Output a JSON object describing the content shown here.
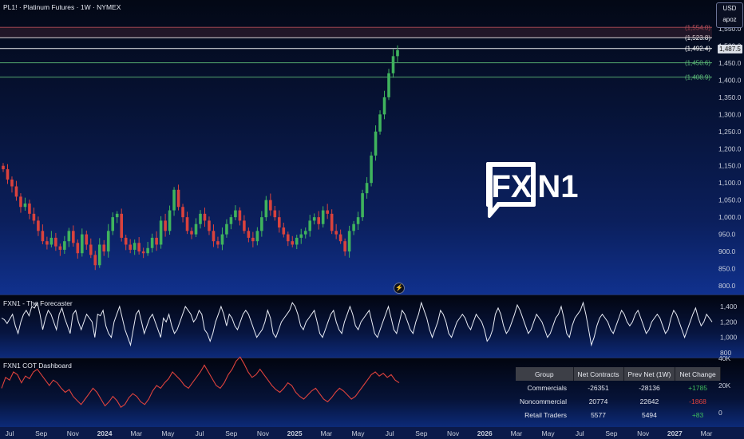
{
  "symbol_title": "PL1! · Platinum Futures · 1W · NYMEX",
  "currency": "USD",
  "scale_mode": "apoz",
  "last_price": "1,487.5",
  "logo_text_left": "FX",
  "logo_text_right": "N1",
  "chart_data": [
    {
      "type": "candlestick",
      "title": "PL1! · Platinum Futures · 1W · NYMEX",
      "y_ticks": [
        "1,550.0",
        "1,500.0",
        "1,450.0",
        "1,400.0",
        "1,350.0",
        "1,300.0",
        "1,250.0",
        "1,200.0",
        "1,150.0",
        "1,100.0",
        "1,050.0",
        "1,000.0",
        "950.0",
        "900.0",
        "850.0",
        "800.0"
      ],
      "ylim": [
        780,
        1560
      ],
      "x_ticks": [
        "Jul",
        "Sep",
        "Nov",
        "2024",
        "Mar",
        "May",
        "Jul",
        "Sep",
        "Nov",
        "2025",
        "Mar",
        "May",
        "Jul",
        "Sep",
        "Nov",
        "2026",
        "Mar",
        "May",
        "Jul",
        "Sep",
        "Nov",
        "2027",
        "Mar"
      ],
      "close_approx": [
        1140,
        1110,
        1090,
        1060,
        1030,
        1040,
        1010,
        990,
        960,
        930,
        920,
        940,
        915,
        905,
        930,
        960,
        925,
        895,
        950,
        920,
        890,
        860,
        920,
        900,
        960,
        1000,
        1010,
        940,
        920,
        905,
        925,
        900,
        895,
        910,
        940,
        920,
        990,
        960,
        1020,
        1080,
        1030,
        1000,
        960,
        950,
        980,
        1010,
        990,
        960,
        930,
        920,
        950,
        980,
        1000,
        1020,
        990,
        960,
        940,
        930,
        960,
        1000,
        1050,
        1020,
        1000,
        970,
        950,
        930,
        920,
        940,
        950,
        960,
        990,
        1000,
        980,
        1020,
        1010,
        960,
        950,
        930,
        900,
        960,
        980,
        1000,
        1070,
        1100,
        1180,
        1250,
        1300,
        1350,
        1420,
        1470,
        1487.5
      ],
      "horizontal_levels": [
        {
          "label": "(1,554.0)",
          "value": 1554.0,
          "color": "#c9555f"
        },
        {
          "label": "(1,523.8)",
          "value": 1523.8,
          "color": "#ffffff"
        },
        {
          "label": "(1,492.4)",
          "value": 1492.4,
          "color": "#ffffff"
        },
        {
          "label": "(1,450.6)",
          "value": 1450.6,
          "color": "#5fbf7a"
        },
        {
          "label": "(1,408.9)",
          "value": 1408.9,
          "color": "#5fbf7a"
        }
      ],
      "last_price": 1487.5
    },
    {
      "type": "line",
      "title": "FXN1 - The Forecaster",
      "y_ticks": [
        "1,400",
        "1,200",
        "1,000",
        "800"
      ],
      "ylim": [
        800,
        1500
      ],
      "values_approx": [
        1250,
        1230,
        1180,
        1240,
        1300,
        1150,
        1050,
        1200,
        1300,
        1350,
        1280,
        1400,
        1380,
        1450,
        1300,
        1100,
        1250,
        1350,
        1300,
        1200,
        1100,
        1300,
        1380,
        1250,
        1150,
        1050,
        1300,
        1350,
        1200,
        1100,
        1200,
        1300,
        1250,
        1200,
        1000,
        1300,
        1280,
        1350,
        1150,
        1050,
        1000,
        1200,
        1300,
        1400,
        1250,
        1100,
        1000,
        900,
        1100,
        1300,
        1350,
        1200,
        1050,
        1150,
        1250,
        1300,
        1200,
        1100,
        1000,
        1250,
        1200,
        1300,
        1150,
        1050,
        1100,
        1200,
        1300,
        1400,
        1350,
        1300,
        1200,
        1250,
        1350,
        1300,
        1100,
        1050,
        950,
        1050,
        1200,
        1300,
        1400,
        1300,
        1150,
        1300,
        1250,
        1150,
        1100,
        1200,
        1300,
        1350,
        1300,
        1200,
        1100,
        1000,
        1050,
        1100,
        1200,
        1350,
        1250,
        1050,
        1000,
        1100,
        1200,
        1250,
        1300,
        1350,
        1450,
        1400,
        1300,
        1150,
        1100,
        1200,
        1250,
        1300,
        1350,
        1200,
        1050,
        1000,
        1100,
        1200,
        1300,
        1350,
        1200,
        1100,
        1050,
        1200,
        1300,
        1400,
        1300,
        1150,
        1100,
        1200,
        1250,
        1300,
        1350,
        1200,
        1050,
        1000,
        1100,
        1200,
        1300,
        1400,
        1250,
        1100,
        1050,
        1200,
        1350,
        1300,
        1200,
        1100,
        1050,
        1200,
        1300,
        1450,
        1350,
        1250,
        1100,
        1000,
        1100,
        1200,
        1350,
        1300,
        1200,
        1050,
        1000,
        1100,
        1200,
        1250,
        1300,
        1250,
        1150,
        1100,
        1200,
        1300,
        1250,
        1200,
        1100,
        950,
        1000,
        1100,
        1300,
        1380,
        1300,
        1150,
        1050,
        1100,
        1200,
        1300,
        1420,
        1350,
        1250,
        1150,
        1050,
        1100,
        1200,
        1300,
        1250,
        1200,
        1100,
        1000,
        1050,
        1150,
        1250,
        1300,
        1400,
        1250,
        1050,
        1000,
        1150,
        1250,
        1300,
        1350,
        1450,
        1300,
        1100,
        900,
        1000,
        1150,
        1250,
        1300,
        1250,
        1200,
        1100,
        1050,
        1150,
        1250,
        1350,
        1300,
        1200,
        1150,
        1200,
        1300,
        1350,
        1250,
        1150,
        1050,
        1100,
        1200,
        1250,
        1300,
        1250,
        1150,
        1050,
        1100,
        1250,
        1350,
        1300,
        1200,
        1100,
        1000,
        1100,
        1200,
        1300,
        1380,
        1250,
        1150,
        1200,
        1300,
        1250,
        1200
      ]
    },
    {
      "type": "line",
      "title": "FXN1 COT Dashboard",
      "y_ticks": [
        "40K",
        "20K",
        "0"
      ],
      "ylim": [
        -5000,
        45000
      ],
      "values_approx": [
        18000,
        26000,
        24000,
        30000,
        28000,
        22000,
        27000,
        25000,
        30000,
        32000,
        28000,
        24000,
        20000,
        24000,
        22000,
        18000,
        15000,
        17000,
        12000,
        9000,
        6000,
        10000,
        14000,
        18000,
        15000,
        10000,
        5000,
        8000,
        12000,
        9000,
        4000,
        6000,
        11000,
        14000,
        12000,
        8000,
        6000,
        10000,
        16000,
        20000,
        18000,
        22000,
        25000,
        30000,
        27000,
        24000,
        20000,
        18000,
        22000,
        26000,
        30000,
        35000,
        30000,
        25000,
        20000,
        18000,
        22000,
        28000,
        32000,
        38000,
        41000,
        36000,
        30000,
        26000,
        28000,
        32000,
        28000,
        24000,
        20000,
        17000,
        15000,
        18000,
        22000,
        20000,
        15000,
        12000,
        10000,
        13000,
        16000,
        18000,
        14000,
        10000,
        8000,
        11000,
        15000,
        18000,
        16000,
        13000,
        10000,
        12000,
        16000,
        20000,
        24000,
        28000,
        30000,
        27000,
        29000,
        26000,
        28000,
        24000,
        22000
      ],
      "table": {
        "headers": [
          "Group",
          "Net Contracts",
          "Prev Net (1W)",
          "Net Change"
        ],
        "rows": [
          {
            "group": "Commercials",
            "net": "-26351",
            "prev": "-28136",
            "change": "+1785",
            "change_color": "#3fbf5c"
          },
          {
            "group": "Noncommercial",
            "net": "20774",
            "prev": "22642",
            "change": "-1868",
            "change_color": "#e0433d"
          },
          {
            "group": "Retail Traders",
            "net": "5577",
            "prev": "5494",
            "change": "+83",
            "change_color": "#3fbf5c"
          }
        ]
      }
    }
  ]
}
